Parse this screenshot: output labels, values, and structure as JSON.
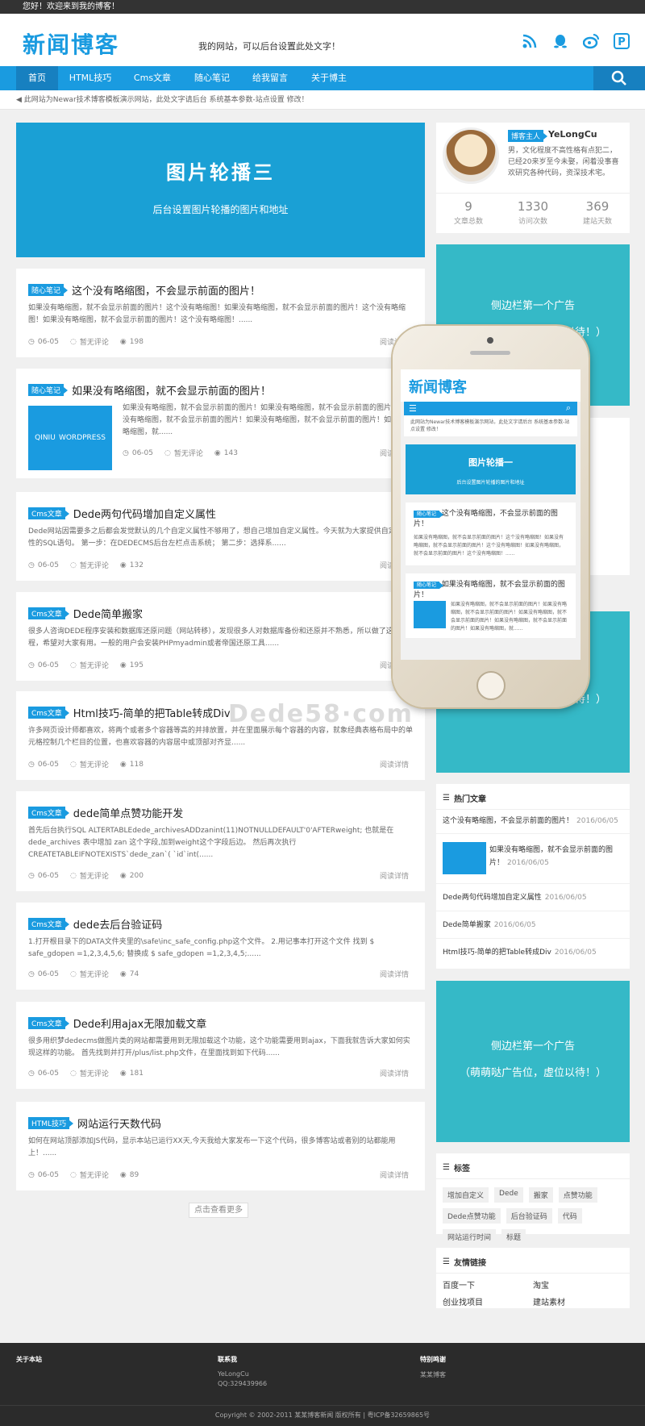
{
  "topbar": {
    "welcome": "您好！欢迎来到我的博客！"
  },
  "header": {
    "logo": "新闻博客",
    "slogan": "我的网站，可以后台设置此处文字！"
  },
  "nav": {
    "items": [
      "首页",
      "HTML技巧",
      "Cms文章",
      "随心笔记",
      "给我留言",
      "关于博主"
    ]
  },
  "notice": "此网站为Newar技术博客模板演示网站，此处文字请后台 系统基本参数-站点设置 修改！",
  "slider": {
    "title": "图片轮播三",
    "subtitle": "后台设置图片轮播的图片和地址"
  },
  "posts": [
    {
      "tag": "随心笔记",
      "title": "这个没有略缩图，不会显示前面的图片！",
      "excerpt": "如果没有略缩图，就不会显示前面的图片！这个没有略缩图！如果没有略缩图，就不会显示前面的图片！这个没有略缩图！如果没有略缩图，就不会显示前面的图片！这个没有略缩图！......",
      "date": "06-05",
      "comment": "暂无评论",
      "views": "198",
      "more": "阅读详情"
    },
    {
      "tag": "随心笔记",
      "title": "如果没有略缩图，就不会显示前面的图片！",
      "excerpt": "如果没有略缩图，就不会显示前面的图片！如果没有略缩图，就不会显示前面的图片！如果没有略缩图，就不会显示前面的图片！如果没有略缩图，就不会显示前面的图片！如果没有略缩图，就......",
      "date": "06-05",
      "comment": "暂无评论",
      "views": "143",
      "more": "阅读详情",
      "thumb": [
        "QINIU",
        "WORDPRESS"
      ]
    },
    {
      "tag": "Cms文章",
      "title": "Dede两句代码增加自定义属性",
      "excerpt": "Dede网站因需要多之后都会发觉默认的几个自定义属性不够用了，想自己增加自定义属性。今天就为大家提供自定义属性的SQL语句。 第一步：在DEDECMS后台左栏点击系统； 第二步：选择系......",
      "date": "06-05",
      "comment": "暂无评论",
      "views": "132",
      "more": "阅读详情"
    },
    {
      "tag": "Cms文章",
      "title": "Dede简单搬家",
      "excerpt": "很多人咨询DEDE程序安装和数据库还原问题（网站转移），发现很多人对数据库备份和还原并不熟悉，所以做了这个教程，希望对大家有用。一般的用户会安装PHPmyadmin或者帝国还原工具......",
      "date": "06-05",
      "comment": "暂无评论",
      "views": "195",
      "more": "阅读详情"
    },
    {
      "tag": "Cms文章",
      "title": "Html技巧-简单的把Table转成Div",
      "excerpt": "许多网页设计师都喜欢，将两个或者多个容器等高的并排放置，并在里面展示每个容器的内容，就象经典表格布局中的单元格控制几个栏目的位置，也喜欢容器的内容居中或顶部对齐显......",
      "date": "06-05",
      "comment": "暂无评论",
      "views": "118",
      "more": "阅读详情"
    },
    {
      "tag": "Cms文章",
      "title": "dede简单点赞功能开发",
      "excerpt": "首先后台执行SQL ALTERTABLEdede_archivesADDzanint(11)NOTNULLDEFAULT'0'AFTERweight; 也就是在dede_archives 表中增加 zan 这个字段,加到weight这个字段后边。 然后再次执行CREATETABLEIFNOTEXISTS`dede_zan`( `id`int(......",
      "date": "06-05",
      "comment": "暂无评论",
      "views": "200",
      "more": "阅读详情"
    },
    {
      "tag": "Cms文章",
      "title": "dede去后台验证码",
      "excerpt": "1.打开根目录下的DATA文件夹里的\\safe\\inc_safe_config.php这个文件。 2.用记事本打开这个文件 找到 $ safe_gdopen =1,2,3,4,5,6; 替换成 $ safe_gdopen =1,2,3,4,5;......",
      "date": "06-05",
      "comment": "暂无评论",
      "views": "74",
      "more": "阅读详情"
    },
    {
      "tag": "Cms文章",
      "title": "Dede利用ajax无限加载文章",
      "excerpt": "很多用织梦dedecms做图片类的网站都需要用到无限加载这个功能，这个功能需要用到ajax，下面我就告诉大家如何实现这样的功能。 首先找到并打开/plus/list.php文件，在里面找到如下代码......",
      "date": "06-05",
      "comment": "暂无评论",
      "views": "181",
      "more": "阅读详情"
    },
    {
      "tag": "HTML技巧",
      "title": "网站运行天数代码",
      "excerpt": "如何在网站顶部添加JS代码，显示本站已运行XX天,今天我给大家发布一下这个代码，很多博客站或者别的站都能用上！......",
      "date": "06-05",
      "comment": "暂无评论",
      "views": "89",
      "more": "阅读详情"
    }
  ],
  "load_more": "点击查看更多",
  "profile": {
    "badge": "博客主人",
    "name": "YeLongCu",
    "bio": "男，文化程度不高性格有点犯二，已经20来岁至今未娶，闲着没事喜欢研究各种代码，资深技术宅。",
    "stats": [
      {
        "value": "9",
        "label": "文章总数"
      },
      {
        "value": "1330",
        "label": "访问次数"
      },
      {
        "value": "369",
        "label": "建站天数"
      }
    ]
  },
  "ad": {
    "line1": "侧边栏第一个广告",
    "line2": "（萌萌哒广告位，虚位以待！）"
  },
  "hot": {
    "title": "热门文章",
    "items": [
      {
        "title": "这个没有略缩图，不会显示前面的图片！",
        "date": "2016/06/05"
      },
      {
        "title": "如果没有略缩图，就不会显示前面的图片！",
        "date": "2016/06/05"
      },
      {
        "title": "Dede两句代码增加自定义属性",
        "date": "2016/06/05"
      },
      {
        "title": "Dede简单搬家",
        "date": "2016/06/05"
      },
      {
        "title": "Html技巧-简单的把Table转成Div",
        "date": "2016/06/05"
      }
    ]
  },
  "tags": {
    "title": "标签",
    "items": [
      "增加自定义",
      "Dede",
      "搬家",
      "点赞功能",
      "Dede点赞功能",
      "后台验证码",
      "代码",
      "网站运行时间",
      "标题"
    ]
  },
  "links": {
    "title": "友情链接",
    "items": [
      "百度一下",
      "淘宝",
      "创业找项目",
      "建站素材"
    ]
  },
  "footer": {
    "about": "关于本站",
    "contact": "联系我",
    "contact_name": "YeLongCu",
    "contact_qq": "QQ:329439966",
    "thanks": "特别鸣谢",
    "thanks_name": "某某博客",
    "copyright": "Copyright © 2002-2011 某某博客新闻 版权所有 | 粤ICP备32659865号"
  },
  "phone": {
    "logo": "新闻博客",
    "notice": "此网站为Newar技术博客模板演示网站，此处文字请后台 系统基本参数-站点设置 修改！",
    "slider_title": "图片轮播一",
    "slider_sub": "后台设置图片轮播的图片和地址"
  },
  "watermark": "Dede58·com"
}
